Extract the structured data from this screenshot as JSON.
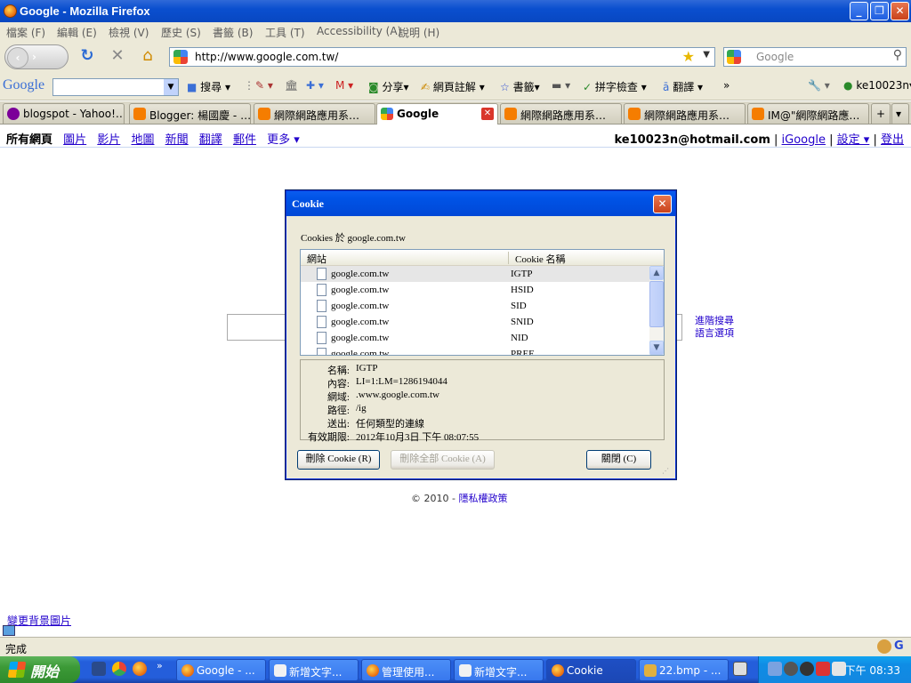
{
  "window": {
    "title": "Google - Mozilla Firefox"
  },
  "menu": [
    "檔案 (F)",
    "編輯 (E)",
    "檢視 (V)",
    "歷史 (S)",
    "書籤 (B)",
    "工具 (T)",
    "Accessibility (A)",
    "說明 (H)"
  ],
  "nav": {
    "url": "http://www.google.com.tw/",
    "search_placeholder": "Google"
  },
  "google_toolbar": {
    "logo": "Google",
    "items": [
      "搜尋",
      "分享",
      "網頁註解",
      "書籤",
      "拼字檢查",
      "翻譯",
      "»",
      "ke10023n"
    ]
  },
  "tabs": [
    {
      "label": "blogspot - Yahoo!…",
      "icon": "yahoo"
    },
    {
      "label": "Blogger: 楊國慶 - …",
      "icon": "blogger"
    },
    {
      "label": "網際網路應用系…",
      "icon": "blogger"
    },
    {
      "label": "Google",
      "icon": "google",
      "active": true
    },
    {
      "label": "網際網路應用系…",
      "icon": "blogger"
    },
    {
      "label": "網際網路應用系…",
      "icon": "blogger"
    },
    {
      "label": "IM@\"網際網路應…",
      "icon": "blogger"
    }
  ],
  "gbar": {
    "current": "所有網頁",
    "links": [
      "圖片",
      "影片",
      "地圖",
      "新聞",
      "翻譯",
      "郵件",
      "更多 ▾"
    ],
    "email": "ke10023n@hotmail.com",
    "right_links": [
      "iGoogle",
      "設定 ▾",
      "登出"
    ]
  },
  "page": {
    "advanced_search": "進階搜尋",
    "language_tools": "語言選項",
    "footer_copy": "© 2010 - ",
    "footer_link": "隱私權政策",
    "bg_link": "變更背景圖片"
  },
  "status": "完成",
  "dialog": {
    "title": "Cookie",
    "cookies_for": "Cookies 於 google.com.tw",
    "col_site": "網站",
    "col_name": "Cookie 名稱",
    "rows": [
      {
        "site": "google.com.tw",
        "name": "IGTP",
        "selected": true
      },
      {
        "site": "google.com.tw",
        "name": "HSID"
      },
      {
        "site": "google.com.tw",
        "name": "SID"
      },
      {
        "site": "google.com.tw",
        "name": "SNID"
      },
      {
        "site": "google.com.tw",
        "name": "NID"
      },
      {
        "site": "google.com.tw",
        "name": "PREF"
      }
    ],
    "details": [
      {
        "k": "名稱:",
        "v": "IGTP"
      },
      {
        "k": "內容:",
        "v": "LI=1:LM=1286194044"
      },
      {
        "k": "網域:",
        "v": ".www.google.com.tw"
      },
      {
        "k": "路徑:",
        "v": "/ig"
      },
      {
        "k": "送出:",
        "v": "任何類型的連線"
      },
      {
        "k": "有效期限:",
        "v": "2012年10月3日 下午 08:07:55"
      }
    ],
    "btn_delete": "刪除 Cookie (R)",
    "btn_delete_all": "刪除全部 Cookie (A)",
    "btn_close": "關閉 (C)"
  },
  "taskbar": {
    "start": "開始",
    "tasks": [
      {
        "label": "Google - ...",
        "icon": "ff"
      },
      {
        "label": "新增文字...",
        "icon": "doc"
      },
      {
        "label": "管理使用...",
        "icon": "ff"
      },
      {
        "label": "新增文字...",
        "icon": "doc"
      },
      {
        "label": "Cookie",
        "icon": "ff",
        "active": true
      },
      {
        "label": "22.bmp - ...",
        "icon": "paint"
      }
    ],
    "clock": "下午 08:33"
  }
}
